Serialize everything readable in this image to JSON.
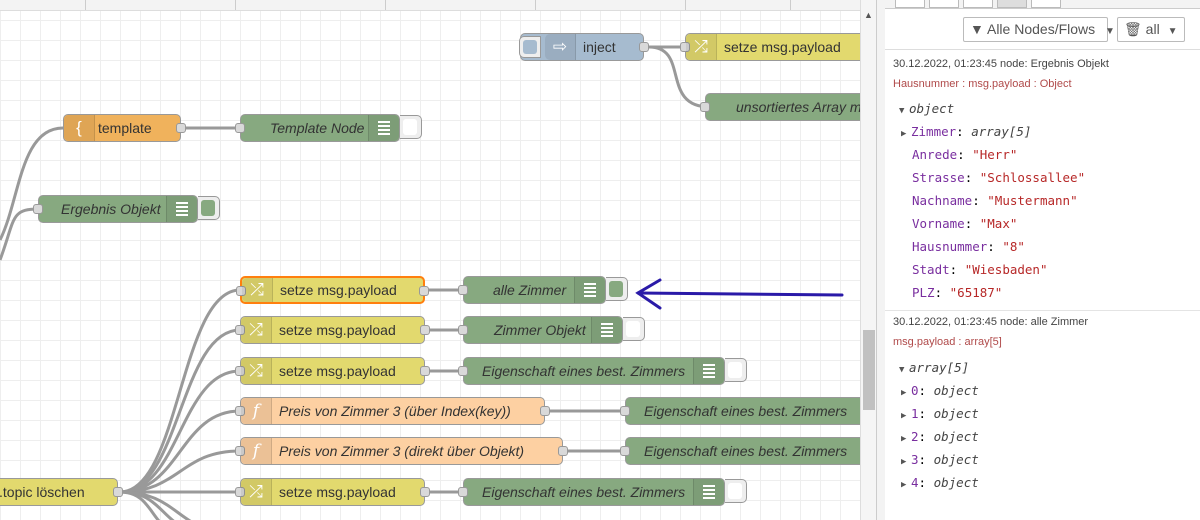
{
  "workspace": {
    "nodes": {
      "inject": "inject",
      "change_top": "setze msg.payload",
      "unsorted": "unsortiertes Array m",
      "template": "template",
      "template_node": "Template Node",
      "ergebnis": "Ergebnis Objekt",
      "change1": "setze msg.payload",
      "alle_zimmer": "alle Zimmer",
      "change2": "setze msg.payload",
      "zimmer_objekt": "Zimmer Objekt",
      "change3": "setze msg.payload",
      "eigenschaft1": "Eigenschaft eines best. Zimmers",
      "func1": "Preis von Zimmer 3 (über Index(key))",
      "eigenschaft2": "Eigenschaft eines best. Zimmers",
      "func2": "Preis von Zimmer 3 (direkt über Objekt)",
      "eigenschaft3": "Eigenschaft eines best. Zimmers",
      "topic": ".topic löschen",
      "change4": "setze msg.payload",
      "eigenschaft4": "Eigenschaft eines best. Zimmers"
    },
    "colors": {
      "inject": "#a6bbcf",
      "change": "#e2d96e",
      "template": "#f0b25c",
      "debug": "#87a980",
      "function": "#fdd0a2",
      "annotation_arrow": "#2a1aa8"
    }
  },
  "sidebar": {
    "filter_button": "Alle Nodes/Flows",
    "clear_button": "all",
    "icons": {
      "filter": "filter-icon",
      "clear": "trash-icon"
    },
    "messages": [
      {
        "meta": "30.12.2022, 01:23:45   node: Ergebnis Objekt",
        "path": "Hausnummer : msg.payload : Object",
        "root": "object",
        "props": [
          {
            "key": "Zimmer",
            "value": "array[5]",
            "kind": "type",
            "expandable": true
          },
          {
            "key": "Anrede",
            "value": "\"Herr\"",
            "kind": "string"
          },
          {
            "key": "Strasse",
            "value": "\"Schlossallee\"",
            "kind": "string"
          },
          {
            "key": "Nachname",
            "value": "\"Mustermann\"",
            "kind": "string"
          },
          {
            "key": "Vorname",
            "value": "\"Max\"",
            "kind": "string"
          },
          {
            "key": "Hausnummer",
            "value": "\"8\"",
            "kind": "string"
          },
          {
            "key": "Stadt",
            "value": "\"Wiesbaden\"",
            "kind": "string"
          },
          {
            "key": "PLZ",
            "value": "\"65187\"",
            "kind": "string"
          }
        ]
      },
      {
        "meta": "30.12.2022, 01:23:45   node: alle Zimmer",
        "path": "msg.payload : array[5]",
        "root": "array[5]",
        "props": [
          {
            "key": "0",
            "value": "object"
          },
          {
            "key": "1",
            "value": "object"
          },
          {
            "key": "2",
            "value": "object"
          },
          {
            "key": "3",
            "value": "object"
          },
          {
            "key": "4",
            "value": "object"
          }
        ]
      }
    ]
  }
}
